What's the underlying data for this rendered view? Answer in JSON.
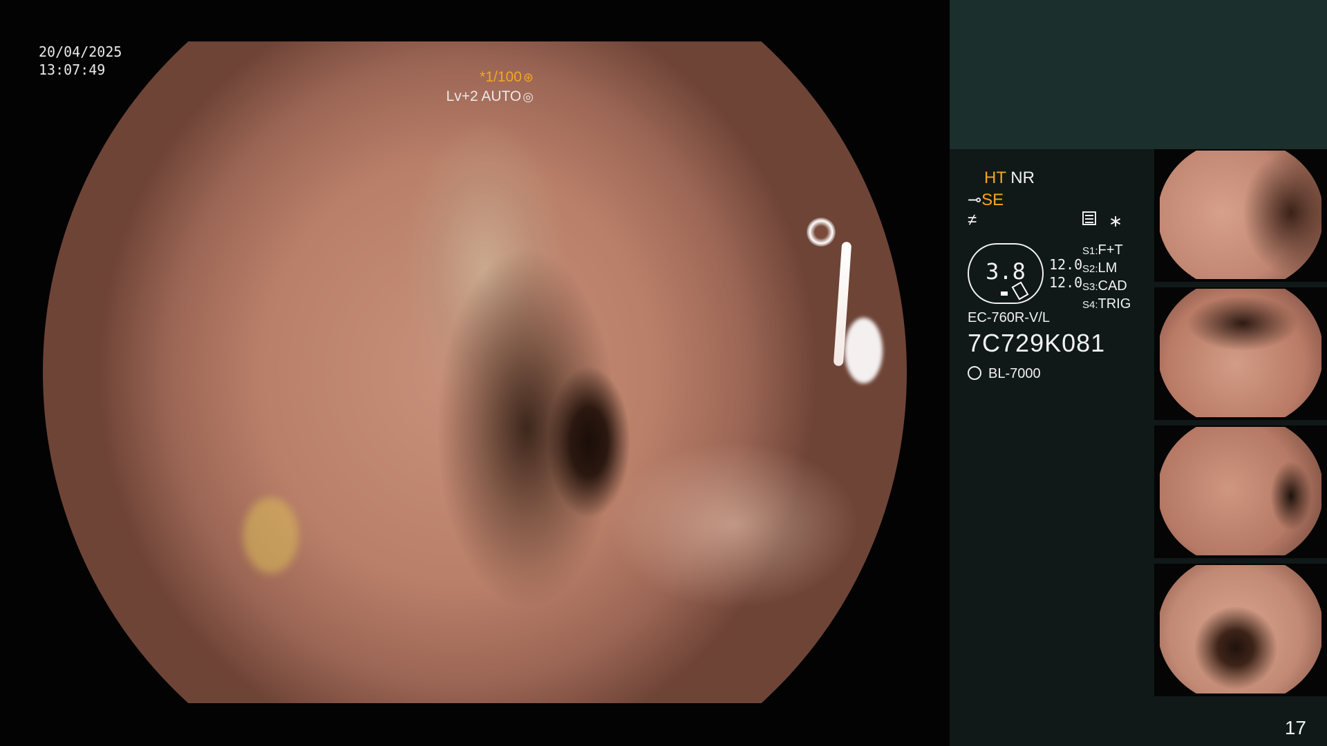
{
  "overlay": {
    "date": "20/04/2025",
    "time": "13:07:49",
    "shutter": "*1/100",
    "level": "Lv+2 AUTO"
  },
  "panel": {
    "mode_line1": {
      "a": "HT",
      "b": "NR"
    },
    "mode_line2": "SE",
    "mode_line3": "≠",
    "gauge_value": "3.8",
    "gauge_nums": [
      "12.0",
      "12.0"
    ],
    "switches": [
      {
        "key": "S1:",
        "value": "F+T"
      },
      {
        "key": "S2:",
        "value": "LM"
      },
      {
        "key": "S3:",
        "value": "CAD"
      },
      {
        "key": "S4:",
        "value": "TRIG"
      }
    ],
    "scope_model": "EC-760R-V/L",
    "serial": "7C729K081",
    "light_source": "BL-7000",
    "page_number": "17"
  },
  "colors": {
    "accent_orange": "#f4a623",
    "panel_bg": "#101917",
    "panel_top_bg": "#1b2f2d",
    "text": "#f2f2f2"
  },
  "icons": [
    "shutter-icon",
    "auto-iris-icon",
    "panel-settings-icon",
    "sun-icon"
  ]
}
